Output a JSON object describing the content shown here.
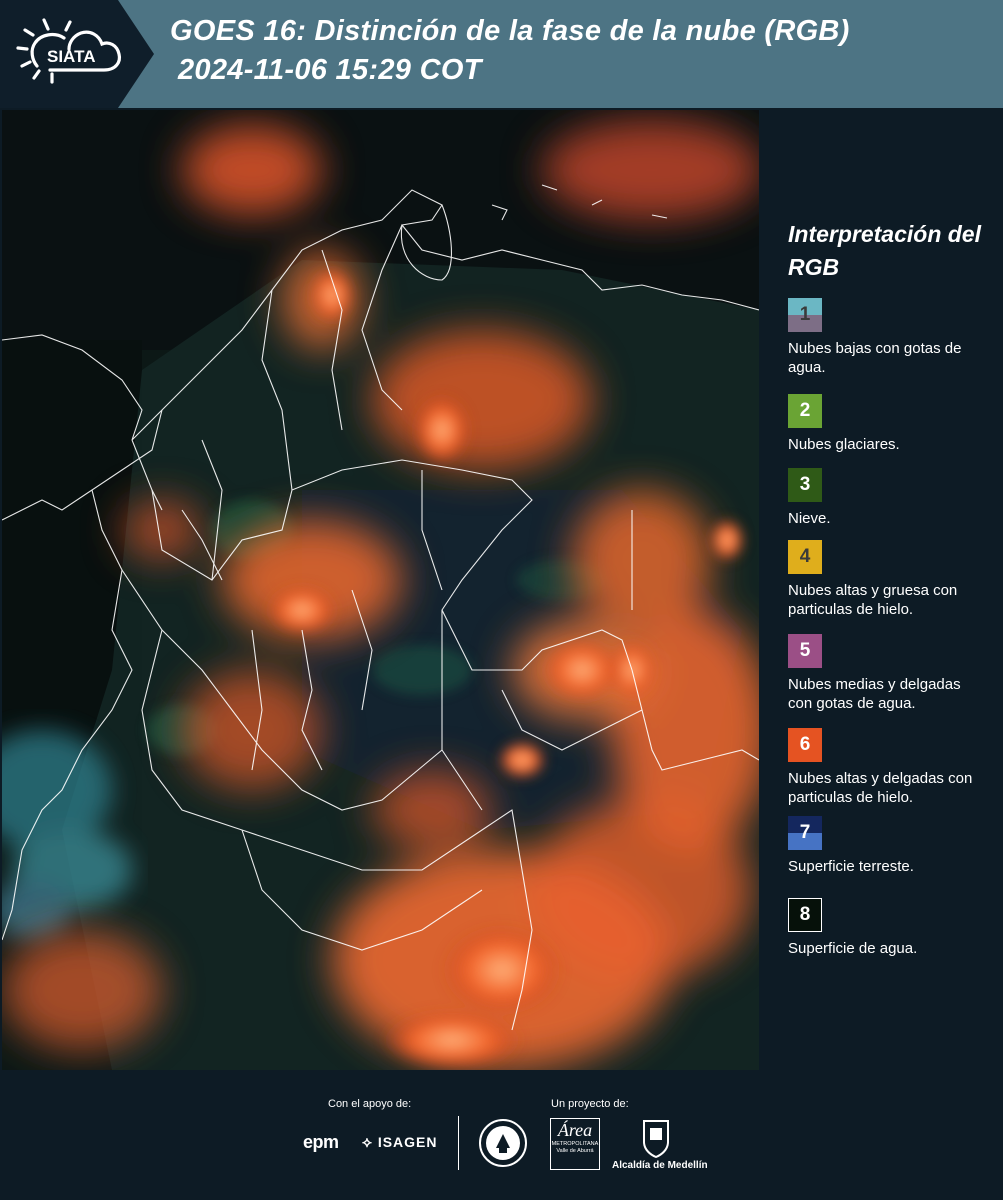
{
  "header": {
    "logo_text": "SIATA",
    "title_line1": "GOES 16: Distinción de la fase de la nube (RGB)",
    "title_line2": "2024-11-06 15:29 COT"
  },
  "legend": {
    "title": "Interpretación del RGB",
    "items": [
      {
        "number": "1",
        "description": "Nubes bajas con gotas de agua.",
        "colors": [
          "#6bb7c4",
          "#7d6e86"
        ],
        "number_color": "#3a3a3a"
      },
      {
        "number": "2",
        "description": "Nubes glaciares.",
        "colors": [
          "#6aa434"
        ],
        "number_color": "#ffffff"
      },
      {
        "number": "3",
        "description": "Nieve.",
        "colors": [
          "#2f5a17"
        ],
        "number_color": "#ffffff"
      },
      {
        "number": "4",
        "description": "Nubes altas y gruesa con particulas de hielo.",
        "colors": [
          "#dfae1c"
        ],
        "number_color": "#3a3a3a"
      },
      {
        "number": "5",
        "description": "Nubes medias y delgadas con gotas de agua.",
        "colors": [
          "#9b4f86"
        ],
        "number_color": "#ffffff"
      },
      {
        "number": "6",
        "description": "Nubes altas y delgadas con particulas de hielo.",
        "colors": [
          "#e55322"
        ],
        "number_color": "#ffffff"
      },
      {
        "number": "7",
        "description": "Superficie terreste.",
        "colors": [
          "#14275e",
          "#4673c4"
        ],
        "number_color": "#ffffff"
      },
      {
        "number": "8",
        "description": "Superficie de agua.",
        "colors": [
          "#06110a"
        ],
        "number_color": "#ffffff"
      }
    ]
  },
  "footer": {
    "support_label": "Con el apoyo de:",
    "project_label": "Un proyecto de:",
    "supporters": [
      "epm",
      "ISAGEN"
    ],
    "area_text": "Área",
    "area_sub1": "METROPOLITANA",
    "area_sub2": "Valle de Aburrá",
    "alcaldia_text": "Alcaldía de Medellín"
  }
}
